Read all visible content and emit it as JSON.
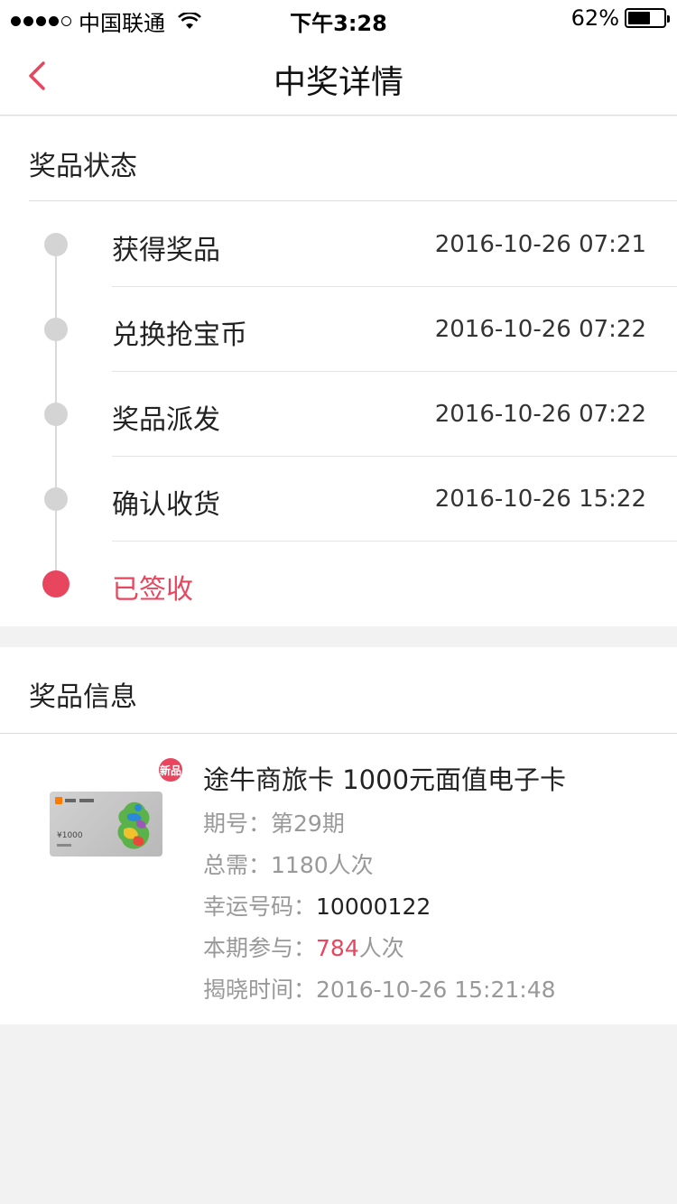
{
  "status_bar": {
    "carrier": "中国联通",
    "time": "下午3:28",
    "battery": "62%",
    "battery_level": 0.62
  },
  "nav": {
    "title": "中奖详情"
  },
  "prize_status": {
    "heading": "奖品状态",
    "steps": [
      {
        "label": "获得奖品",
        "time": "2016-10-26 07:21"
      },
      {
        "label": "兑换抢宝币",
        "time": "2016-10-26 07:22"
      },
      {
        "label": "奖品派发",
        "time": "2016-10-26 07:22"
      },
      {
        "label": "确认收货",
        "time": "2016-10-26 15:22"
      },
      {
        "label": "已签收",
        "time": ""
      }
    ]
  },
  "prize_info": {
    "heading": "奖品信息",
    "badge": "新品",
    "product_title": "途牛商旅卡 1000元面值电子卡",
    "card_amount": "¥1000",
    "period_label": "期号：",
    "period_value": "第29期",
    "total_label": "总需：",
    "total_value": "1180人次",
    "lucky_label": "幸运号码：",
    "lucky_value": "10000122",
    "participate_label": "本期参与：",
    "participate_count": "784",
    "participate_unit": "人次",
    "reveal_label": "揭晓时间：",
    "reveal_value": "2016-10-26 15:21:48"
  },
  "colors": {
    "accent": "#e8465f",
    "inactive_dot": "#d4d4d4",
    "background": "#f2f2f2"
  }
}
